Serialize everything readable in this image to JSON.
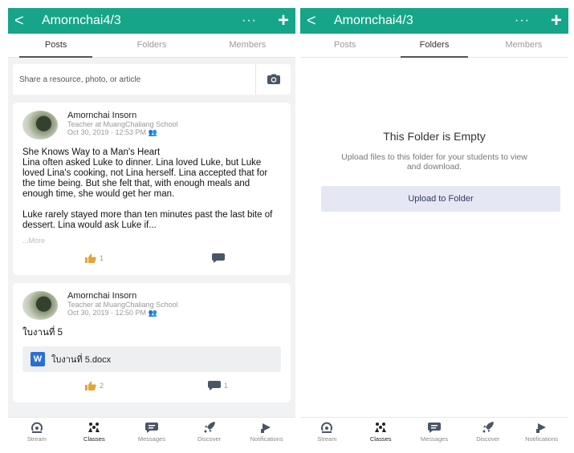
{
  "left": {
    "header": {
      "back": "<",
      "title": "Amornchai4/3",
      "more": "···",
      "add": "+"
    },
    "tabs": [
      "Posts",
      "Folders",
      "Members"
    ],
    "share_placeholder": "Share a resource, photo, or article",
    "posts": [
      {
        "author": "Amornchai Insorn",
        "role": "Teacher at MuangChaliang School",
        "date": "Oct 30, 2019 · 12:53 PM",
        "p1": "She Knows Way to a Man's Heart",
        "p2": "Lina often asked Luke to dinner. Lina loved Luke, but Luke loved Lina's cooking, not Lina herself. Lina accepted that for the time being. But she felt that, with enough meals and enough time, she would get her man.",
        "p3": "Luke rarely stayed more than ten minutes past the last bite of dessert. Lina would ask Luke if...",
        "more": "...More",
        "likes": "1",
        "comments": ""
      },
      {
        "author": "Amornchai Insorn",
        "role": "Teacher at MuangChaliang School",
        "date": "Oct 30, 2019 · 12:50 PM",
        "text": "ใบงานที่ 5",
        "file": "ใบงานที่ 5.docx",
        "file_icon": "W",
        "likes": "2",
        "comments": "1"
      }
    ],
    "nav": [
      "Stream",
      "Classes",
      "Messages",
      "Discover",
      "Notifications"
    ]
  },
  "right": {
    "header": {
      "back": "<",
      "title": "Amornchai4/3",
      "more": "···",
      "add": "+"
    },
    "tabs": [
      "Posts",
      "Folders",
      "Members"
    ],
    "empty_title": "This Folder is Empty",
    "empty_desc": "Upload files to this folder for your students to view and download.",
    "upload_label": "Upload to Folder",
    "nav": [
      "Stream",
      "Classes",
      "Messages",
      "Discover",
      "Notifications"
    ]
  },
  "colors": {
    "accent": "#17a589",
    "upload_bg": "#e6e7f4",
    "word_blue": "#2b6fd6"
  }
}
